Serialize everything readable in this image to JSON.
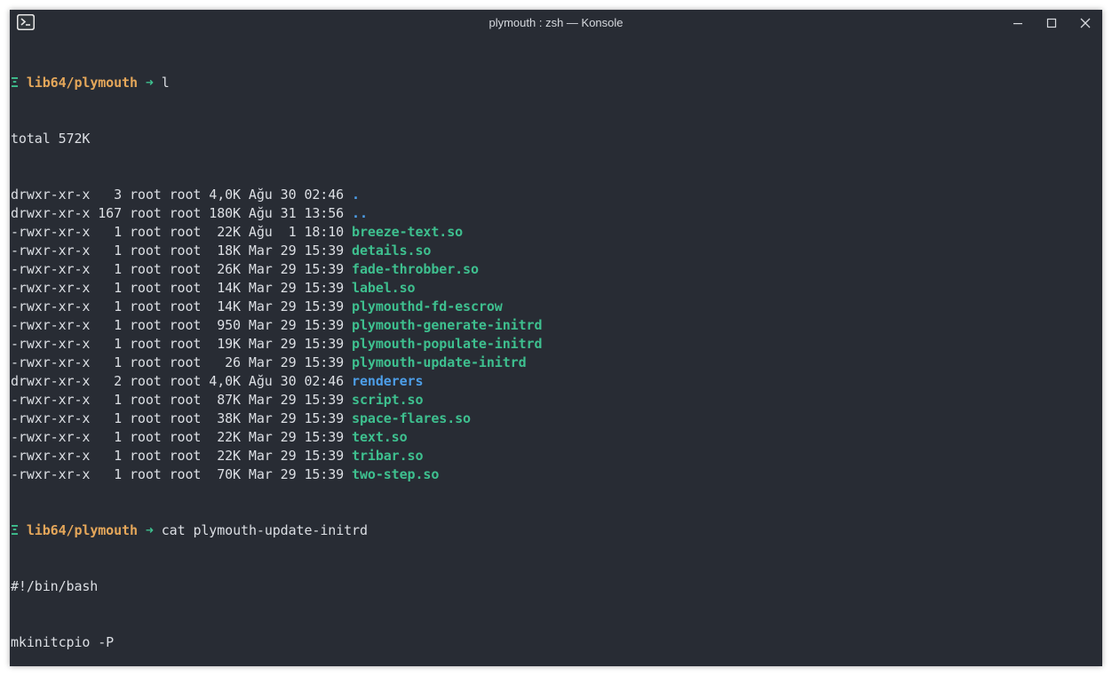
{
  "window": {
    "title": "plymouth : zsh — Konsole",
    "app_icon": "konsole-terminal-icon",
    "controls": [
      "minimize-icon",
      "maximize-icon",
      "close-icon"
    ]
  },
  "colors": {
    "background": "#282c34",
    "text": "#dcdfe4",
    "prompt_symbol": "#3ec08f",
    "prompt_dir": "#e5a75a",
    "executable": "#3ec08f",
    "directory": "#4d9ee8"
  },
  "prompt": {
    "symbol": "Ξ",
    "dir": "lib64/plymouth",
    "arrow": "➜"
  },
  "commands": {
    "first": "l",
    "second": "cat plymouth-update-initrd"
  },
  "ls_total": "total 572K",
  "ls_entries": [
    {
      "meta": "drwxr-xr-x   3 root root 4,0K Ağu 30 02:46 ",
      "name": ".",
      "type": "dir"
    },
    {
      "meta": "drwxr-xr-x 167 root root 180K Ağu 31 13:56 ",
      "name": "..",
      "type": "dir"
    },
    {
      "meta": "-rwxr-xr-x   1 root root  22K Ağu  1 18:10 ",
      "name": "breeze-text.so",
      "type": "exec"
    },
    {
      "meta": "-rwxr-xr-x   1 root root  18K Mar 29 15:39 ",
      "name": "details.so",
      "type": "exec"
    },
    {
      "meta": "-rwxr-xr-x   1 root root  26K Mar 29 15:39 ",
      "name": "fade-throbber.so",
      "type": "exec"
    },
    {
      "meta": "-rwxr-xr-x   1 root root  14K Mar 29 15:39 ",
      "name": "label.so",
      "type": "exec"
    },
    {
      "meta": "-rwxr-xr-x   1 root root  14K Mar 29 15:39 ",
      "name": "plymouthd-fd-escrow",
      "type": "exec"
    },
    {
      "meta": "-rwxr-xr-x   1 root root  950 Mar 29 15:39 ",
      "name": "plymouth-generate-initrd",
      "type": "exec"
    },
    {
      "meta": "-rwxr-xr-x   1 root root  19K Mar 29 15:39 ",
      "name": "plymouth-populate-initrd",
      "type": "exec"
    },
    {
      "meta": "-rwxr-xr-x   1 root root   26 Mar 29 15:39 ",
      "name": "plymouth-update-initrd",
      "type": "exec"
    },
    {
      "meta": "drwxr-xr-x   2 root root 4,0K Ağu 30 02:46 ",
      "name": "renderers",
      "type": "dir"
    },
    {
      "meta": "-rwxr-xr-x   1 root root  87K Mar 29 15:39 ",
      "name": "script.so",
      "type": "exec"
    },
    {
      "meta": "-rwxr-xr-x   1 root root  38K Mar 29 15:39 ",
      "name": "space-flares.so",
      "type": "exec"
    },
    {
      "meta": "-rwxr-xr-x   1 root root  22K Mar 29 15:39 ",
      "name": "text.so",
      "type": "exec"
    },
    {
      "meta": "-rwxr-xr-x   1 root root  22K Mar 29 15:39 ",
      "name": "tribar.so",
      "type": "exec"
    },
    {
      "meta": "-rwxr-xr-x   1 root root  70K Mar 29 15:39 ",
      "name": "two-step.so",
      "type": "exec"
    }
  ],
  "cat_output": [
    "#!/bin/bash",
    "mkinitcpio -P"
  ]
}
